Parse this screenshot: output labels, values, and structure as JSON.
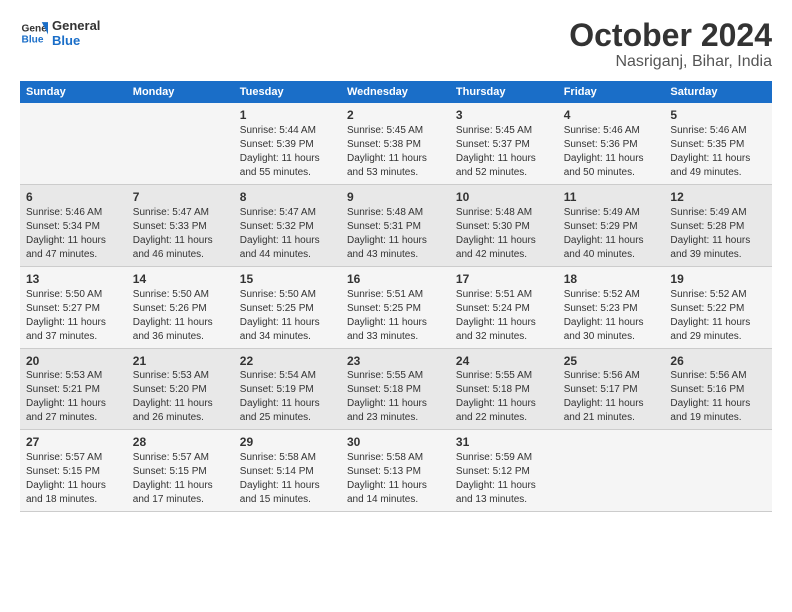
{
  "header": {
    "logo_line1": "General",
    "logo_line2": "Blue",
    "month": "October 2024",
    "location": "Nasriganj, Bihar, India"
  },
  "days_of_week": [
    "Sunday",
    "Monday",
    "Tuesday",
    "Wednesday",
    "Thursday",
    "Friday",
    "Saturday"
  ],
  "weeks": [
    [
      {
        "num": "",
        "info": ""
      },
      {
        "num": "",
        "info": ""
      },
      {
        "num": "1",
        "info": "Sunrise: 5:44 AM\nSunset: 5:39 PM\nDaylight: 11 hours and 55 minutes."
      },
      {
        "num": "2",
        "info": "Sunrise: 5:45 AM\nSunset: 5:38 PM\nDaylight: 11 hours and 53 minutes."
      },
      {
        "num": "3",
        "info": "Sunrise: 5:45 AM\nSunset: 5:37 PM\nDaylight: 11 hours and 52 minutes."
      },
      {
        "num": "4",
        "info": "Sunrise: 5:46 AM\nSunset: 5:36 PM\nDaylight: 11 hours and 50 minutes."
      },
      {
        "num": "5",
        "info": "Sunrise: 5:46 AM\nSunset: 5:35 PM\nDaylight: 11 hours and 49 minutes."
      }
    ],
    [
      {
        "num": "6",
        "info": "Sunrise: 5:46 AM\nSunset: 5:34 PM\nDaylight: 11 hours and 47 minutes."
      },
      {
        "num": "7",
        "info": "Sunrise: 5:47 AM\nSunset: 5:33 PM\nDaylight: 11 hours and 46 minutes."
      },
      {
        "num": "8",
        "info": "Sunrise: 5:47 AM\nSunset: 5:32 PM\nDaylight: 11 hours and 44 minutes."
      },
      {
        "num": "9",
        "info": "Sunrise: 5:48 AM\nSunset: 5:31 PM\nDaylight: 11 hours and 43 minutes."
      },
      {
        "num": "10",
        "info": "Sunrise: 5:48 AM\nSunset: 5:30 PM\nDaylight: 11 hours and 42 minutes."
      },
      {
        "num": "11",
        "info": "Sunrise: 5:49 AM\nSunset: 5:29 PM\nDaylight: 11 hours and 40 minutes."
      },
      {
        "num": "12",
        "info": "Sunrise: 5:49 AM\nSunset: 5:28 PM\nDaylight: 11 hours and 39 minutes."
      }
    ],
    [
      {
        "num": "13",
        "info": "Sunrise: 5:50 AM\nSunset: 5:27 PM\nDaylight: 11 hours and 37 minutes."
      },
      {
        "num": "14",
        "info": "Sunrise: 5:50 AM\nSunset: 5:26 PM\nDaylight: 11 hours and 36 minutes."
      },
      {
        "num": "15",
        "info": "Sunrise: 5:50 AM\nSunset: 5:25 PM\nDaylight: 11 hours and 34 minutes."
      },
      {
        "num": "16",
        "info": "Sunrise: 5:51 AM\nSunset: 5:25 PM\nDaylight: 11 hours and 33 minutes."
      },
      {
        "num": "17",
        "info": "Sunrise: 5:51 AM\nSunset: 5:24 PM\nDaylight: 11 hours and 32 minutes."
      },
      {
        "num": "18",
        "info": "Sunrise: 5:52 AM\nSunset: 5:23 PM\nDaylight: 11 hours and 30 minutes."
      },
      {
        "num": "19",
        "info": "Sunrise: 5:52 AM\nSunset: 5:22 PM\nDaylight: 11 hours and 29 minutes."
      }
    ],
    [
      {
        "num": "20",
        "info": "Sunrise: 5:53 AM\nSunset: 5:21 PM\nDaylight: 11 hours and 27 minutes."
      },
      {
        "num": "21",
        "info": "Sunrise: 5:53 AM\nSunset: 5:20 PM\nDaylight: 11 hours and 26 minutes."
      },
      {
        "num": "22",
        "info": "Sunrise: 5:54 AM\nSunset: 5:19 PM\nDaylight: 11 hours and 25 minutes."
      },
      {
        "num": "23",
        "info": "Sunrise: 5:55 AM\nSunset: 5:18 PM\nDaylight: 11 hours and 23 minutes."
      },
      {
        "num": "24",
        "info": "Sunrise: 5:55 AM\nSunset: 5:18 PM\nDaylight: 11 hours and 22 minutes."
      },
      {
        "num": "25",
        "info": "Sunrise: 5:56 AM\nSunset: 5:17 PM\nDaylight: 11 hours and 21 minutes."
      },
      {
        "num": "26",
        "info": "Sunrise: 5:56 AM\nSunset: 5:16 PM\nDaylight: 11 hours and 19 minutes."
      }
    ],
    [
      {
        "num": "27",
        "info": "Sunrise: 5:57 AM\nSunset: 5:15 PM\nDaylight: 11 hours and 18 minutes."
      },
      {
        "num": "28",
        "info": "Sunrise: 5:57 AM\nSunset: 5:15 PM\nDaylight: 11 hours and 17 minutes."
      },
      {
        "num": "29",
        "info": "Sunrise: 5:58 AM\nSunset: 5:14 PM\nDaylight: 11 hours and 15 minutes."
      },
      {
        "num": "30",
        "info": "Sunrise: 5:58 AM\nSunset: 5:13 PM\nDaylight: 11 hours and 14 minutes."
      },
      {
        "num": "31",
        "info": "Sunrise: 5:59 AM\nSunset: 5:12 PM\nDaylight: 11 hours and 13 minutes."
      },
      {
        "num": "",
        "info": ""
      },
      {
        "num": "",
        "info": ""
      }
    ]
  ]
}
